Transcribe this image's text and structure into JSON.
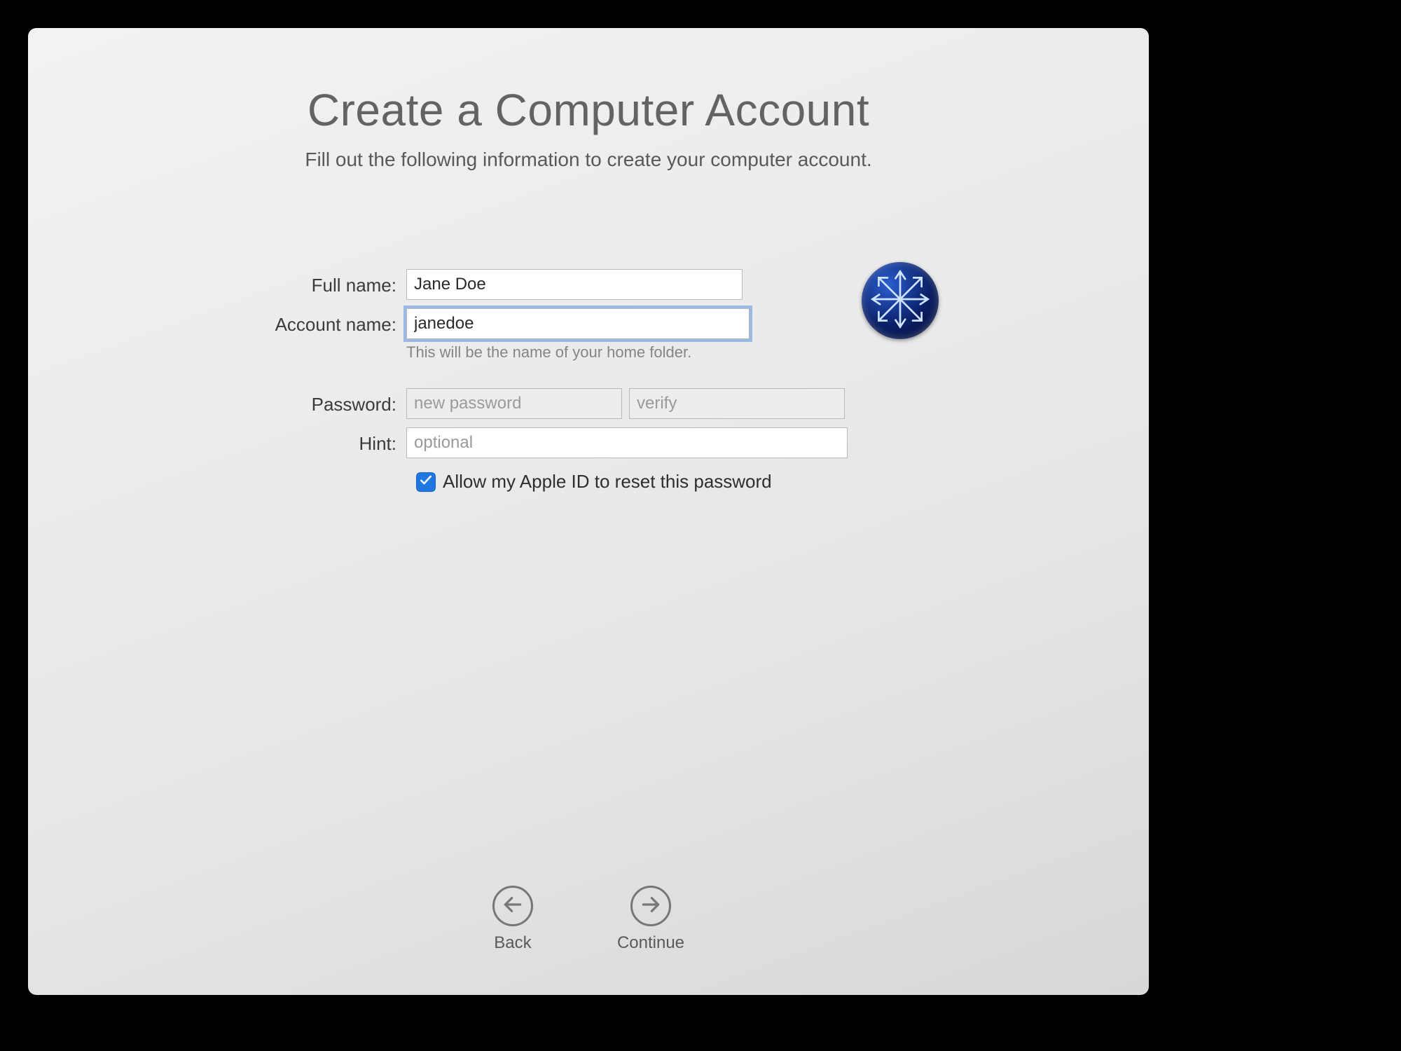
{
  "header": {
    "title": "Create a Computer Account",
    "subtitle": "Fill out the following information to create your computer account."
  },
  "form": {
    "full_name": {
      "label": "Full name:",
      "value": "Jane Doe"
    },
    "account_name": {
      "label": "Account name:",
      "value": "janedoe",
      "hint": "This will be the name of your home folder."
    },
    "password": {
      "label": "Password:",
      "new_placeholder": "new password",
      "verify_placeholder": "verify"
    },
    "hint_field": {
      "label": "Hint:",
      "placeholder": "optional"
    },
    "apple_id_checkbox": {
      "checked": true,
      "label": "Allow my Apple ID to reset this password"
    },
    "avatar_icon": "snowflake-avatar"
  },
  "nav": {
    "back": "Back",
    "continue": "Continue"
  }
}
